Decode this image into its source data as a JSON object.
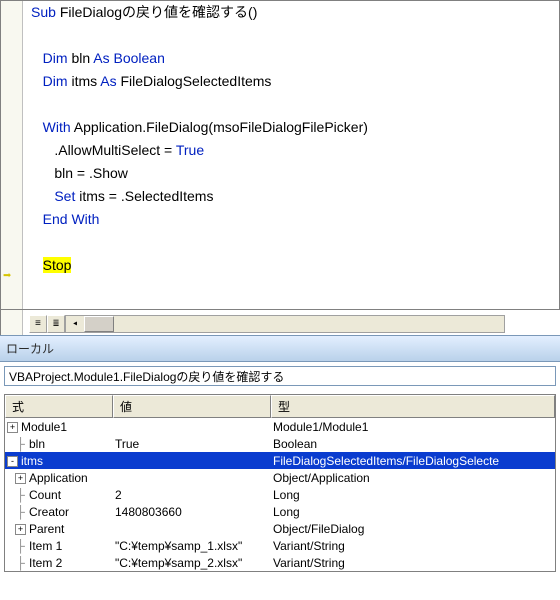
{
  "code": {
    "line1_sub": "Sub",
    "line1_name": "FileDialogの戻り値を確認する()",
    "line3_dim": "Dim",
    "line3_var": " bln ",
    "line3_as": "As Boolean",
    "line4_dim": "Dim",
    "line4_var": " itms ",
    "line4_as": "As",
    "line4_type": " FileDialogSelectedItems",
    "line6_with": "With",
    "line6_rest": " Application.FileDialog(msoFileDialogFilePicker)",
    "line7": ".AllowMultiSelect = ",
    "line7_true": "True",
    "line8": "bln = .Show",
    "line9_set": "Set",
    "line9_rest": " itms = .SelectedItems",
    "line10": "End With",
    "line12_stop": "Stop"
  },
  "panel_title": "ローカル",
  "context": "VBAProject.Module1.FileDialogの戻り値を確認する",
  "headers": {
    "expr": "式",
    "val": "値",
    "type": "型"
  },
  "rows": [
    {
      "icon": "+",
      "depth": 0,
      "expr": "Module1",
      "val": "",
      "type": "Module1/Module1"
    },
    {
      "icon": "",
      "depth": 1,
      "expr": "bln",
      "val": "True",
      "type": "Boolean"
    },
    {
      "icon": "-",
      "depth": 0,
      "expr": "itms",
      "val": "",
      "type": "FileDialogSelectedItems/FileDialogSelecte",
      "selected": true
    },
    {
      "icon": "+",
      "depth": 1,
      "expr": "Application",
      "val": "",
      "type": "Object/Application"
    },
    {
      "icon": "",
      "depth": 1,
      "expr": "Count",
      "val": "2",
      "type": "Long"
    },
    {
      "icon": "",
      "depth": 1,
      "expr": "Creator",
      "val": "1480803660",
      "type": "Long"
    },
    {
      "icon": "+",
      "depth": 1,
      "expr": "Parent",
      "val": "",
      "type": "Object/FileDialog"
    },
    {
      "icon": "",
      "depth": 1,
      "expr": "Item 1",
      "val": "\"C:¥temp¥samp_1.xlsx\"",
      "type": "Variant/String"
    },
    {
      "icon": "",
      "depth": 1,
      "expr": "Item 2",
      "val": "\"C:¥temp¥samp_2.xlsx\"",
      "type": "Variant/String"
    }
  ]
}
